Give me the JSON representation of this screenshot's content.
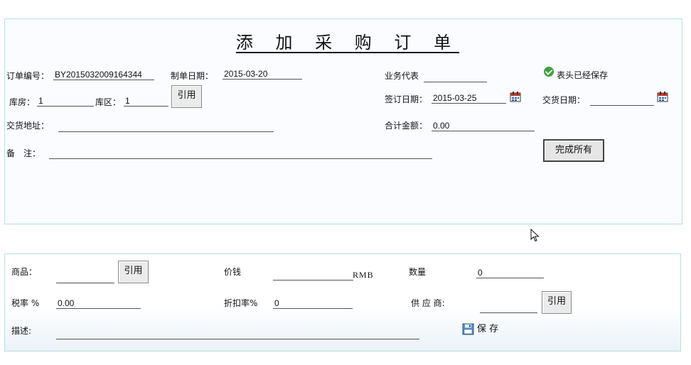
{
  "header": {
    "title": "添 加 采 购 订 单",
    "order_no_label": "订单编号：",
    "order_no": "BY2015032009164344",
    "make_date_label": "制单日期：",
    "make_date": "2015-03-20",
    "sales_rep_label": "业务代表",
    "sales_rep": "",
    "saved_status": "表头已经保存",
    "warehouse_label": "库房：",
    "warehouse": "1",
    "zone_label": "库区：",
    "zone": "1",
    "quote_label": "引用",
    "sign_date_label": "签订日期：",
    "sign_date": "2015-03-25",
    "delivery_date_label": "交货日期：",
    "delivery_date": "",
    "address_label": "交货地址：",
    "address": "",
    "total_label": "合计金额：",
    "total": "0.00",
    "remark_label": "备　注：",
    "remark": "",
    "complete_all_label": "完成所有"
  },
  "item": {
    "product_label": "商品：",
    "product": "",
    "product_quote_label": "引用",
    "price_label": "价钱",
    "price": "",
    "currency": "RMB",
    "qty_label": "数量",
    "qty": "0",
    "tax_label": "税率 %",
    "tax": "0.00",
    "discount_label": "折扣率%",
    "discount": "0",
    "supplier_label": "供 应 商:",
    "supplier": "",
    "supplier_quote_label": "引用",
    "desc_label": "描述:",
    "desc": "",
    "save_label": "保 存"
  },
  "icons": {
    "calendar": "calendar-icon",
    "check": "check-icon",
    "save": "save-icon",
    "cursor": "mouse-cursor-icon"
  }
}
